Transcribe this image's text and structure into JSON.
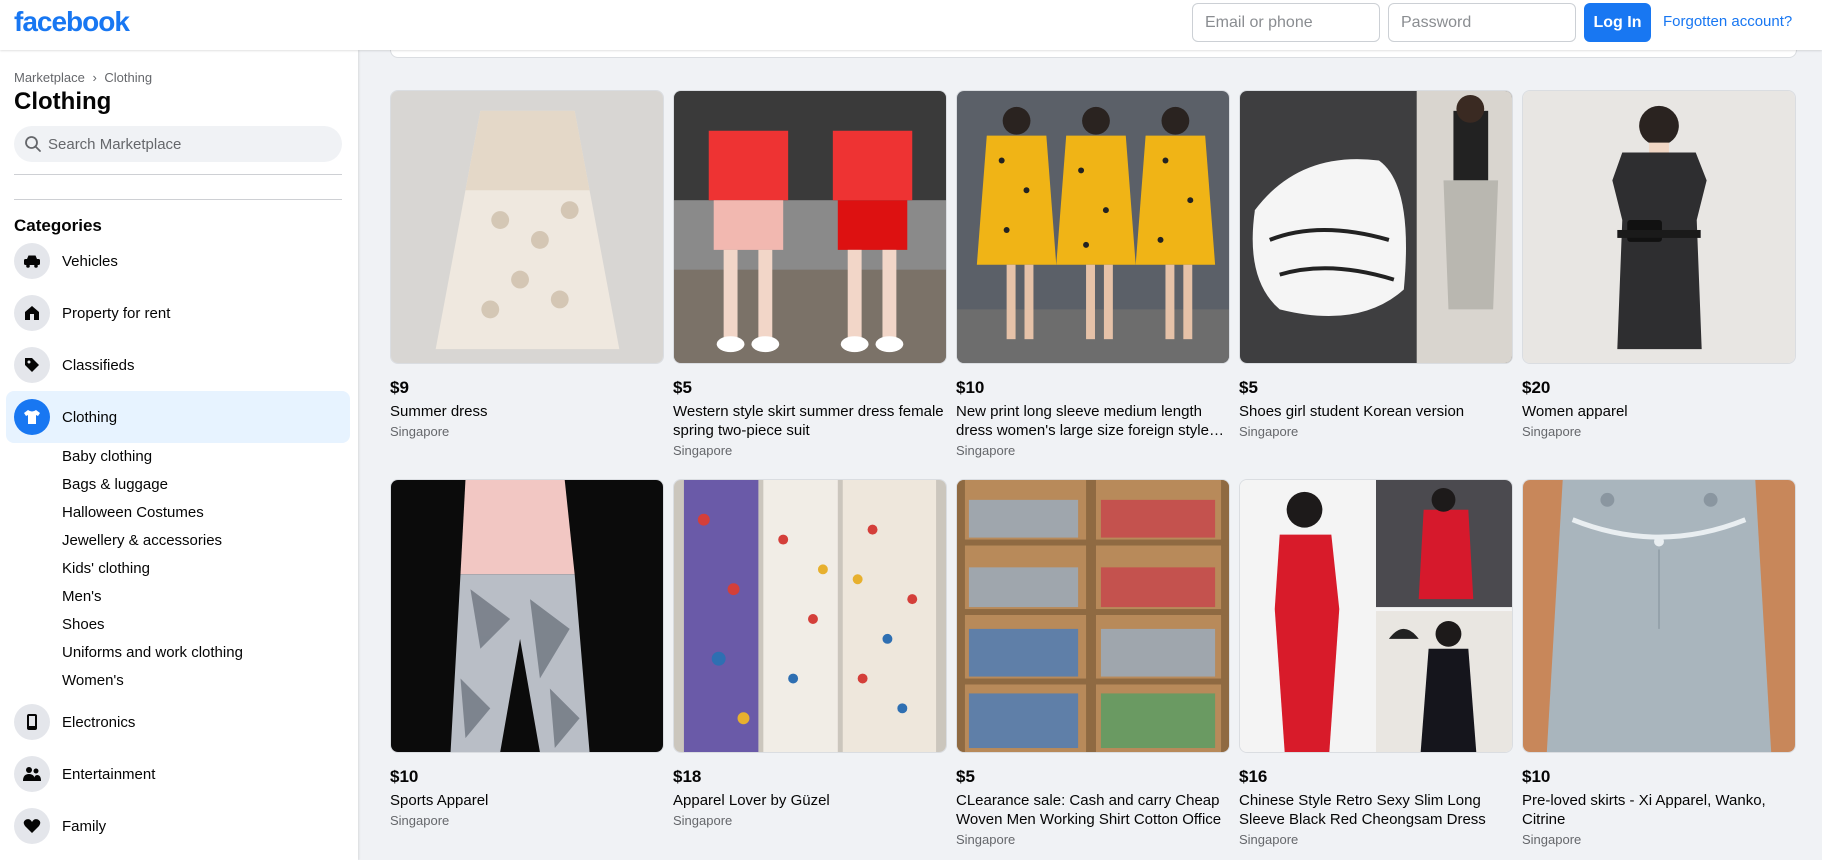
{
  "header": {
    "logo": "facebook",
    "email_placeholder": "Email or phone",
    "password_placeholder": "Password",
    "login_label": "Log In",
    "forgot_label": "Forgotten account?"
  },
  "sidebar": {
    "breadcrumb": [
      "Marketplace",
      "›",
      "Clothing"
    ],
    "title": "Clothing",
    "search_placeholder": "Search Marketplace",
    "categories_heading": "Categories",
    "categories": [
      {
        "label": "Vehicles",
        "icon": "car-icon"
      },
      {
        "label": "Property for rent",
        "icon": "house-icon"
      },
      {
        "label": "Classifieds",
        "icon": "tag-icon"
      },
      {
        "label": "Clothing",
        "icon": "shirt-icon"
      }
    ],
    "subcategories": [
      "Baby clothing",
      "Bags & luggage",
      "Halloween Costumes",
      "Jewellery & accessories",
      "Kids' clothing",
      "Men's",
      "Shoes",
      "Uniforms and work clothing",
      "Women's"
    ],
    "more_categories": [
      {
        "label": "Electronics",
        "icon": "phone-icon"
      },
      {
        "label": "Entertainment",
        "icon": "people-icon"
      },
      {
        "label": "Family",
        "icon": "heart-icon"
      }
    ]
  },
  "listings": [
    {
      "price": "$9",
      "title": "Summer dress",
      "location": "Singapore"
    },
    {
      "price": "$5",
      "title": "Western style skirt summer dress female spring two-piece suit",
      "location": "Singapore"
    },
    {
      "price": "$10",
      "title": "New print long sleeve medium length dress women's large size foreign style loose",
      "location": "Singapore"
    },
    {
      "price": "$5",
      "title": "Shoes girl student Korean version",
      "location": "Singapore"
    },
    {
      "price": "$20",
      "title": "Women apparel",
      "location": "Singapore"
    },
    {
      "price": "$10",
      "title": "Sports Apparel",
      "location": "Singapore"
    },
    {
      "price": "$18",
      "title": "Apparel Lover by Güzel",
      "location": "Singapore"
    },
    {
      "price": "$5",
      "title": "CLearance sale: Cash and carry Cheap Woven Men Working Shirt Cotton Office",
      "location": "Singapore"
    },
    {
      "price": "$16",
      "title": "Chinese Style Retro Sexy Slim Long Sleeve Black Red Cheongsam Dress",
      "location": "Singapore"
    },
    {
      "price": "$10",
      "title": "Pre-loved skirts - Xi Apparel, Wanko, Citrine",
      "location": "Singapore"
    }
  ],
  "colors": {
    "brand": "#1877f2",
    "active_bg": "#e7f3ff",
    "muted_text": "#65676b"
  }
}
